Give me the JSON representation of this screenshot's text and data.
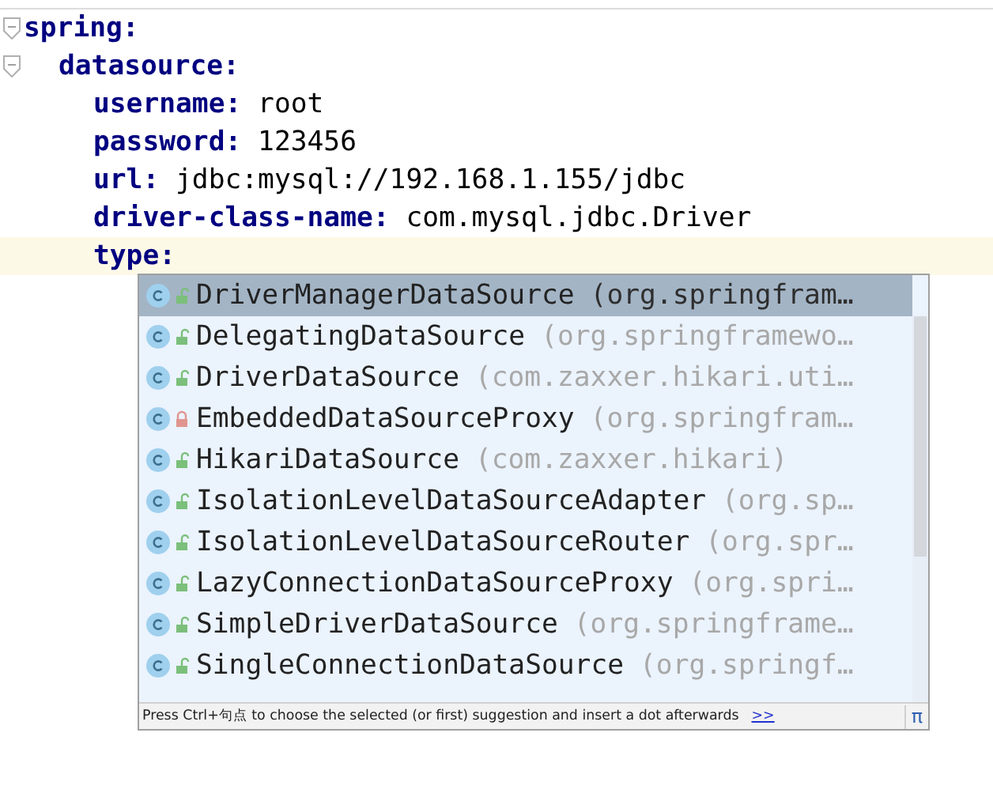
{
  "editor": {
    "lines": [
      {
        "key": "spring:",
        "current": false,
        "children": [
          {
            "key": "datasource:",
            "current": false,
            "children": [
              {
                "key": "username:",
                "value": "root",
                "current": false
              },
              {
                "key": "password:",
                "value": "123456",
                "current": false
              },
              {
                "key": "url:",
                "value": "jdbc:mysql://192.168.1.155/jdbc",
                "current": false
              },
              {
                "key": "driver-class-name:",
                "value": "com.mysql.jdbc.Driver",
                "current": false
              },
              {
                "key": "type:",
                "current": true
              }
            ]
          }
        ]
      }
    ]
  },
  "completion": {
    "items": [
      {
        "name": "DriverManagerDataSource",
        "package": "(org.springfram…",
        "kind": "public",
        "selected": true
      },
      {
        "name": "DelegatingDataSource",
        "package": "(org.springframewo…",
        "kind": "public",
        "selected": false
      },
      {
        "name": "DriverDataSource",
        "package": "(com.zaxxer.hikari.uti…",
        "kind": "public",
        "selected": false
      },
      {
        "name": "EmbeddedDataSourceProxy",
        "package": "(org.springfram…",
        "kind": "private",
        "selected": false
      },
      {
        "name": "HikariDataSource",
        "package": "(com.zaxxer.hikari)",
        "kind": "public",
        "selected": false
      },
      {
        "name": "IsolationLevelDataSourceAdapter",
        "package": "(org.sp…",
        "kind": "public",
        "selected": false
      },
      {
        "name": "IsolationLevelDataSourceRouter",
        "package": "(org.spr…",
        "kind": "public",
        "selected": false
      },
      {
        "name": "LazyConnectionDataSourceProxy",
        "package": "(org.spri…",
        "kind": "public",
        "selected": false
      },
      {
        "name": "SimpleDriverDataSource",
        "package": "(org.springframe…",
        "kind": "public",
        "selected": false
      },
      {
        "name": "SingleConnectionDataSource",
        "package": "(org.springf…",
        "kind": "public",
        "selected": false
      }
    ],
    "hint": "Press Ctrl+句点 to choose the selected (or first) suggestion and insert a dot afterwards",
    "hint_link": ">>",
    "pi": "π"
  }
}
